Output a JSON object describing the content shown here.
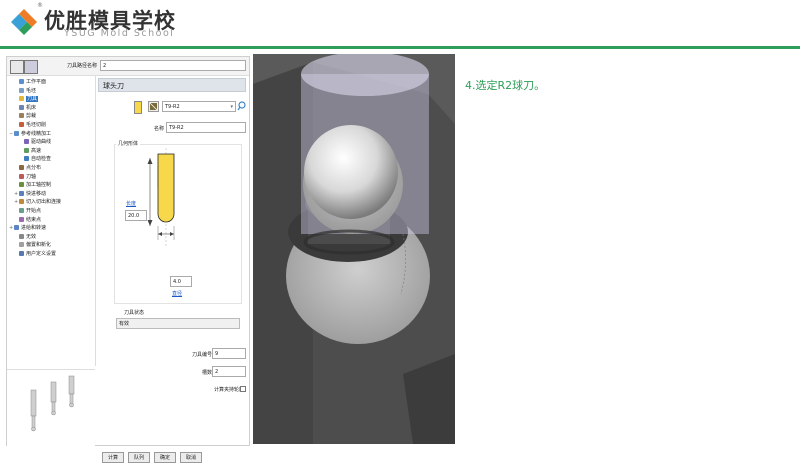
{
  "header": {
    "brand_cn": "优胜模具学校",
    "brand_en": "YSUG Mold School",
    "reg_mark": "®",
    "accent_color": "#2f9e5a"
  },
  "toolbar": {
    "path_name_label": "刀具路径名称",
    "path_name_value": "2"
  },
  "tree": {
    "items": [
      {
        "label": "工作平面",
        "icon": "plane-icon",
        "indent": 1
      },
      {
        "label": "毛坯",
        "icon": "stock-icon",
        "indent": 1
      },
      {
        "label": "刀具",
        "icon": "tool-icon",
        "indent": 1,
        "selected": true
      },
      {
        "label": "机床",
        "icon": "machine-icon",
        "indent": 1
      },
      {
        "label": "剪裁",
        "icon": "trim-icon",
        "indent": 1
      },
      {
        "label": "毛坯切削",
        "icon": "cut-icon",
        "indent": 1
      },
      {
        "label": "参考线精加工",
        "icon": "pattern-icon",
        "indent": 0,
        "expand": "−"
      },
      {
        "label": "驱动曲线",
        "icon": "curve-icon",
        "indent": 2
      },
      {
        "label": "高速",
        "icon": "speed-icon",
        "indent": 2
      },
      {
        "label": "自动检查",
        "icon": "check-icon",
        "indent": 2
      },
      {
        "label": "点分布",
        "icon": "points-icon",
        "indent": 1
      },
      {
        "label": "刀轴",
        "icon": "axis-icon",
        "indent": 1
      },
      {
        "label": "加工轴控制",
        "icon": "axis-ctrl-icon",
        "indent": 1
      },
      {
        "label": "快进移动",
        "icon": "rapid-icon",
        "indent": 1,
        "expand": "+"
      },
      {
        "label": "切入切出和连接",
        "icon": "leadin-icon",
        "indent": 1,
        "expand": "+"
      },
      {
        "label": "开始点",
        "icon": "start-icon",
        "indent": 1
      },
      {
        "label": "结束点",
        "icon": "end-icon",
        "indent": 1
      },
      {
        "label": "进给和转速",
        "icon": "feed-icon",
        "indent": 0,
        "expand": "+"
      },
      {
        "label": "无效",
        "icon": "null-icon",
        "indent": 1
      },
      {
        "label": "偏置和新化",
        "icon": "offset-icon",
        "indent": 1
      },
      {
        "label": "用户定义设置",
        "icon": "user-icon",
        "indent": 1
      }
    ]
  },
  "panel": {
    "title": "球头刀",
    "tool_dropdown": "T9-R2",
    "name_label": "名称",
    "name_value": "T9-R2",
    "geometry_title": "几何形体",
    "length_link": "长度",
    "length_value": "20.0",
    "diameter_value": "4.0",
    "diameter_link": "直径",
    "state_label": "刀具状态",
    "state_value": "有效",
    "tool_number_label": "刀具编号",
    "tool_number_value": "9",
    "flutes_label": "槽数",
    "flutes_value": "2",
    "calc_label": "计算夹持轮廓",
    "buttons": [
      "计算",
      "队列",
      "确定",
      "取消"
    ]
  },
  "note": "4.选定R2球刀。",
  "colors": {
    "tool_yellow": "#f6d84a",
    "selection_blue": "#3074c4",
    "link_blue": "#1a57c9",
    "note_green": "#2e9f58"
  }
}
